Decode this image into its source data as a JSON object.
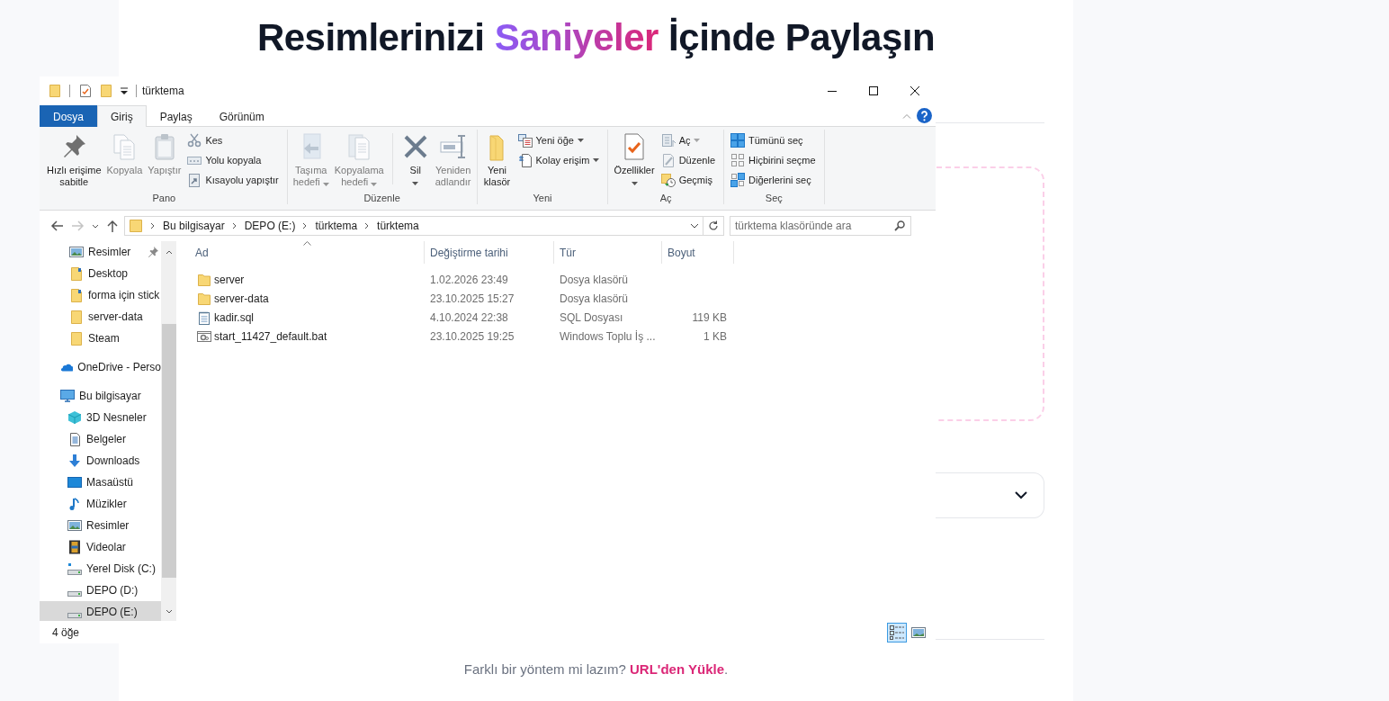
{
  "page": {
    "heading": [
      {
        "text": "Resimlerinizi ",
        "kind": "plain"
      },
      {
        "text": "Saniyeler",
        "kind": "accent"
      },
      {
        "text": " İçinde Paylaşın",
        "kind": "plain"
      }
    ],
    "accordion": {
      "expanded": false
    },
    "footer": {
      "text": "Farklı bir yöntem mi lazım?",
      "link": "URL'den Yükle",
      "tail": "."
    }
  },
  "explorer": {
    "title": "türktema",
    "tabs": [
      {
        "label": "Dosya",
        "kind": "file",
        "selected": false
      },
      {
        "label": "Giriş",
        "kind": "tab",
        "selected": true
      },
      {
        "label": "Paylaş",
        "kind": "tab",
        "selected": false
      },
      {
        "label": "Görünüm",
        "kind": "tab",
        "selected": false
      }
    ],
    "ribbon": [
      {
        "name": "Pano",
        "items": [
          {
            "label": "Hızlı erişime\nsabitle",
            "kind": "large",
            "disabled": false,
            "dropdown": false
          },
          {
            "label": "Kopyala",
            "kind": "large",
            "disabled": true,
            "dropdown": false
          },
          {
            "label": "Yapıştır",
            "kind": "large",
            "disabled": true,
            "dropdown": false
          },
          {
            "label": "Kes",
            "kind": "small",
            "disabled": true,
            "dropdown": false
          },
          {
            "label": "Yolu kopyala",
            "kind": "small",
            "disabled": true,
            "dropdown": false
          },
          {
            "label": "Kısayolu yapıştır",
            "kind": "small",
            "disabled": true,
            "dropdown": false
          }
        ]
      },
      {
        "name": "Düzenle",
        "items": [
          {
            "label": "Taşıma\nhedefi",
            "kind": "large",
            "disabled": true,
            "dropdown": true
          },
          {
            "label": "Kopyalama\nhedefi",
            "kind": "large",
            "disabled": true,
            "dropdown": true
          },
          {
            "kind": "separator"
          },
          {
            "label": "Sil",
            "kind": "large",
            "disabled": false,
            "dropdown": true
          },
          {
            "label": "Yeniden\nadlandır",
            "kind": "large",
            "disabled": true,
            "dropdown": false
          }
        ]
      },
      {
        "name": "Yeni",
        "items": [
          {
            "label": "Yeni\nklasör",
            "kind": "large",
            "disabled": false,
            "dropdown": false
          },
          {
            "label": "Yeni öğe",
            "kind": "small",
            "disabled": false,
            "dropdown": true
          },
          {
            "label": "Kolay erişim",
            "kind": "small",
            "disabled": false,
            "dropdown": true
          }
        ]
      },
      {
        "name": "Aç",
        "items": [
          {
            "label": "Özellikler",
            "kind": "large",
            "disabled": false,
            "dropdown": true
          },
          {
            "label": "Aç",
            "kind": "small",
            "disabled": true,
            "dropdown": true
          },
          {
            "label": "Düzenle",
            "kind": "small",
            "disabled": true,
            "dropdown": false
          },
          {
            "label": "Geçmiş",
            "kind": "small",
            "disabled": false,
            "dropdown": false
          }
        ]
      },
      {
        "name": "Seç",
        "items": [
          {
            "label": "Tümünü seç",
            "kind": "small",
            "disabled": false,
            "dropdown": false
          },
          {
            "label": "Hiçbirini seçme",
            "kind": "small",
            "disabled": false,
            "dropdown": false
          },
          {
            "label": "Diğerlerini seç",
            "kind": "small",
            "disabled": false,
            "dropdown": false
          }
        ]
      }
    ],
    "navigation": {
      "back_disabled": false,
      "forward_disabled": true
    },
    "address": [
      "Bu bilgisayar",
      "DEPO (E:)",
      "türktema",
      "türktema"
    ],
    "search": {
      "placeholder": "türktema klasöründe ara"
    },
    "nav": {
      "quick_access": [
        {
          "label": "Resimler",
          "pinned": true,
          "selected": false
        },
        {
          "label": "Desktop",
          "pinned": false,
          "selected": false
        },
        {
          "label": "forma için stick",
          "pinned": false,
          "selected": false
        },
        {
          "label": "server-data",
          "pinned": false,
          "selected": false
        },
        {
          "label": "Steam",
          "pinned": false,
          "selected": false
        }
      ],
      "roots": [
        {
          "label": "OneDrive - Perso",
          "selected": false
        },
        {
          "label": "Bu bilgisayar",
          "selected": false,
          "children": [
            {
              "label": "3D Nesneler",
              "selected": false
            },
            {
              "label": "Belgeler",
              "selected": false
            },
            {
              "label": "Downloads",
              "selected": false
            },
            {
              "label": "Masaüstü",
              "selected": false
            },
            {
              "label": "Müzikler",
              "selected": false
            },
            {
              "label": "Resimler",
              "selected": false
            },
            {
              "label": "Videolar",
              "selected": false
            },
            {
              "label": "Yerel Disk (C:)",
              "selected": false
            },
            {
              "label": "DEPO (D:)",
              "selected": false
            },
            {
              "label": "DEPO (E:)",
              "selected": true
            }
          ]
        }
      ]
    },
    "columns": [
      {
        "label": "Ad",
        "sorted": true
      },
      {
        "label": "Değiştirme tarihi",
        "sorted": false
      },
      {
        "label": "Tür",
        "sorted": false
      },
      {
        "label": "Boyut",
        "sorted": false
      }
    ],
    "rows": [
      {
        "kind": "folder",
        "name": "server",
        "date": "1.02.2026 23:49",
        "type": "Dosya klasörü",
        "selected": false
      },
      {
        "kind": "folder",
        "name": "server-data",
        "date": "23.10.2025 15:27",
        "type": "Dosya klasörü",
        "selected": false
      },
      {
        "kind": "text",
        "name": "kadir.sql",
        "date": "4.10.2024 22:38",
        "type": "SQL Dosyası",
        "size": "119 KB",
        "selected": false
      },
      {
        "kind": "batch",
        "name": "start_11427_default.bat",
        "date": "23.10.2025 19:25",
        "type": "Windows Toplu İş ...",
        "size": "1 KB",
        "selected": false
      }
    ],
    "status_bar": {
      "count": "4 öğe",
      "views": [
        {
          "selected": true
        },
        {
          "selected": false
        }
      ]
    }
  }
}
